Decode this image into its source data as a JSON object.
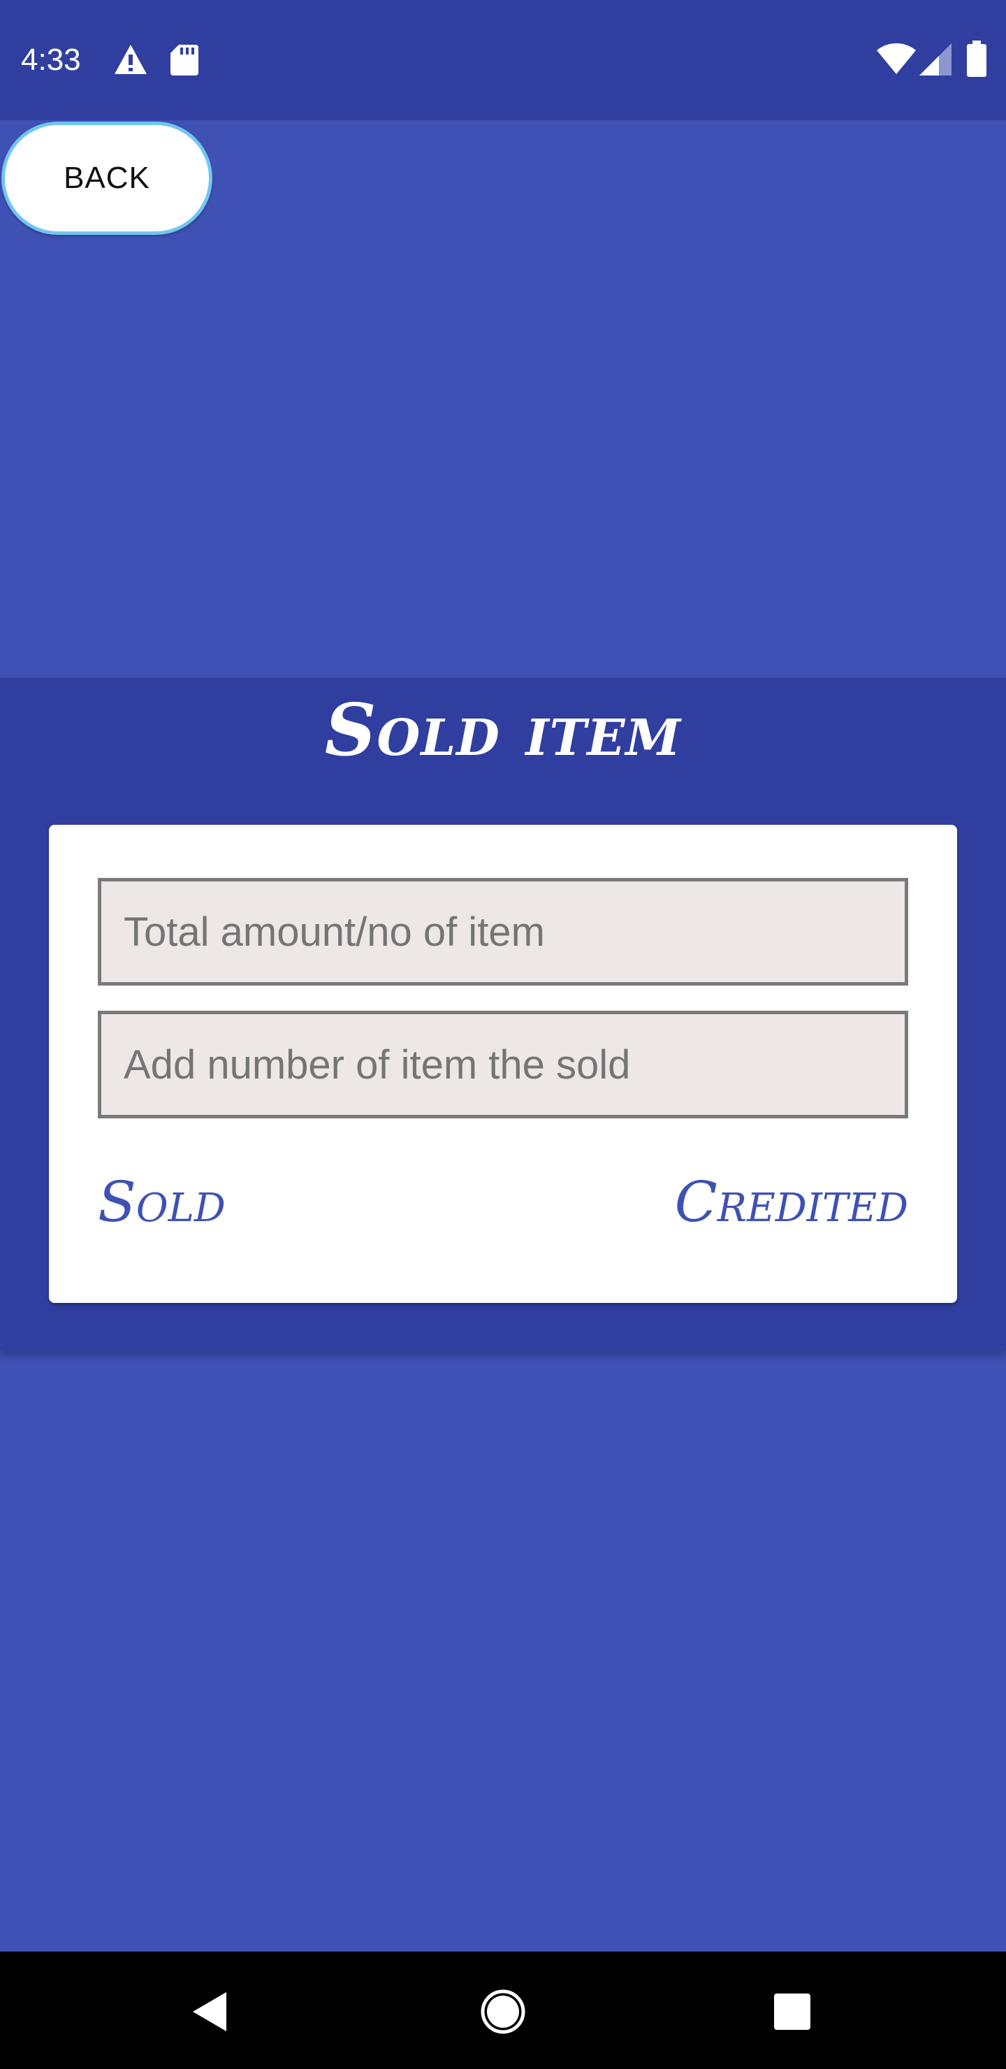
{
  "status_bar": {
    "time": "4:33",
    "icons": [
      "warning-icon",
      "sd-card-icon",
      "wifi-icon",
      "signal-icon",
      "battery-icon"
    ]
  },
  "back_button": {
    "label": "BACK"
  },
  "sold_panel": {
    "title": "Sold item",
    "total_field": {
      "placeholder": "Total amount/no of item",
      "value": ""
    },
    "sold_count_field": {
      "placeholder": "Add number of item the sold",
      "value": ""
    },
    "sold_action": "Sold",
    "credited_action": "Credited"
  },
  "nav_bar": {
    "icons": [
      "back-triangle-icon",
      "home-circle-icon",
      "recents-square-icon"
    ]
  },
  "colors": {
    "background": "#3f51b5",
    "status_bar": "#303f9f",
    "panel": "#303f9f",
    "card": "#ffffff",
    "field_fill": "#ede7e7",
    "field_border": "#7a7a7a",
    "action_text": "#3f51b5",
    "back_button_border": "#72c6f2"
  }
}
